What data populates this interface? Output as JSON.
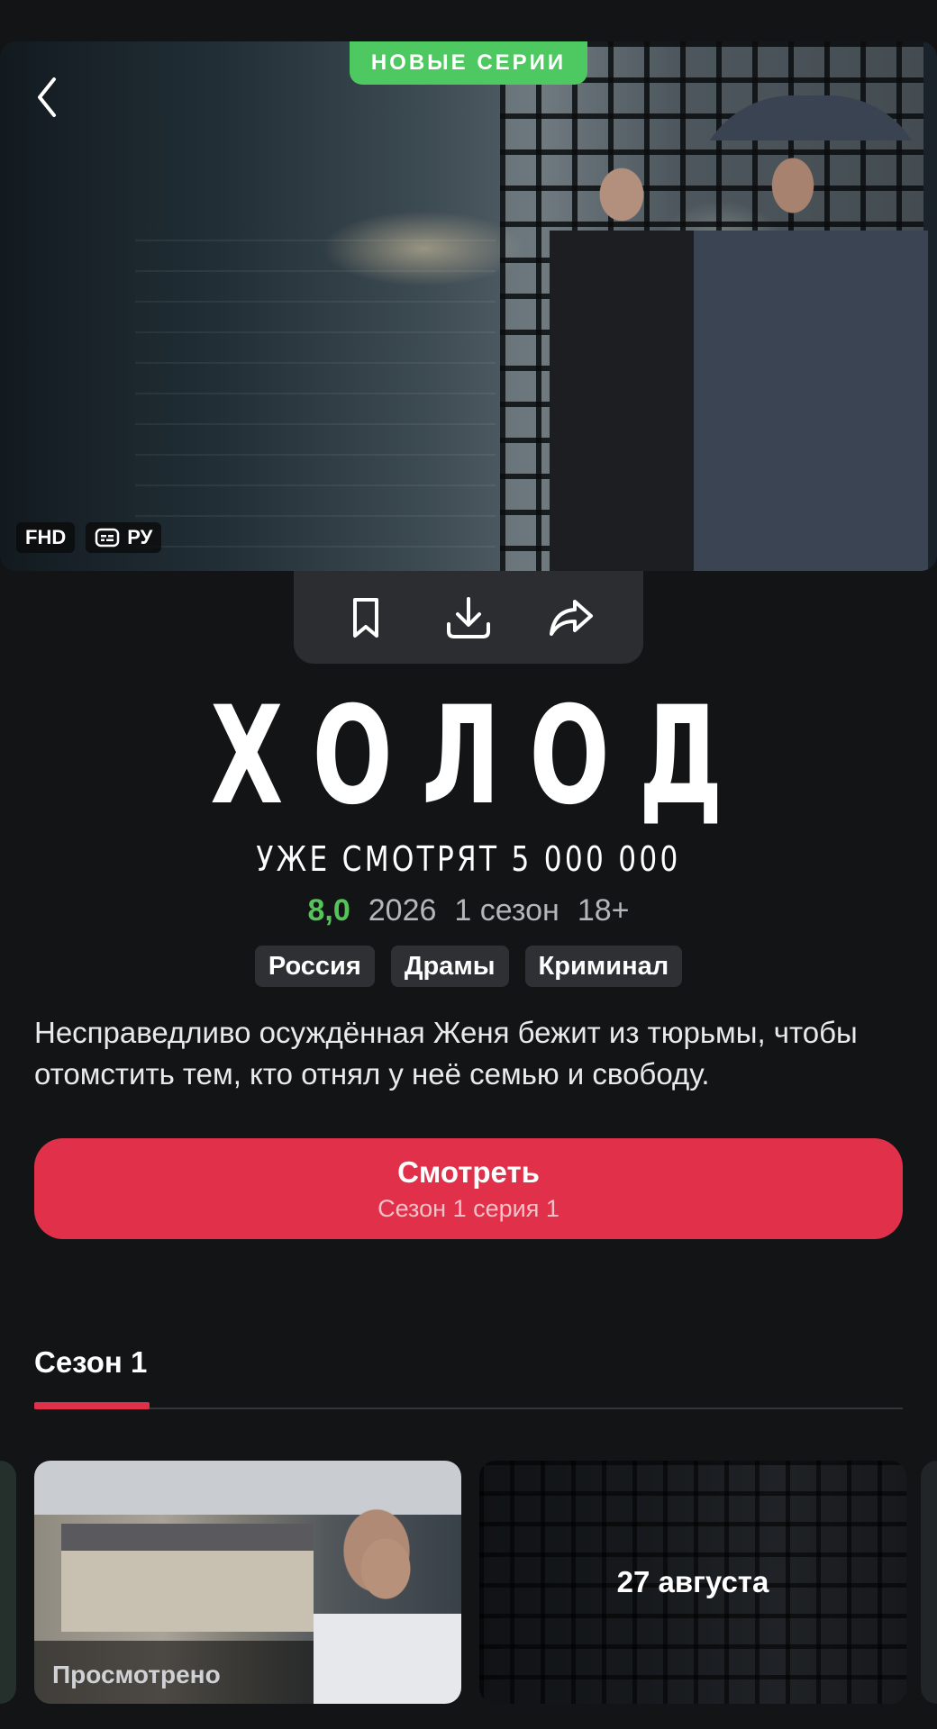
{
  "hero": {
    "badge": "НОВЫЕ СЕРИИ",
    "quality": "FHD",
    "subtitles": "РУ"
  },
  "show": {
    "title": "ХОЛОД",
    "watching": "УЖЕ СМОТРЯТ 5 000 000",
    "rating": "8,0",
    "year": "2026",
    "seasons": "1 сезон",
    "age": "18+",
    "genres": [
      "Россия",
      "Драмы",
      "Криминал"
    ],
    "description": "Несправедливо осуждённая Женя бежит из тюрьмы, чтобы отомстить тем, кто отнял у неё семью и свободу."
  },
  "watch_button": {
    "label": "Смотреть",
    "sublabel": "Сезон 1 серия 1"
  },
  "tabs": [
    {
      "label": "Сезон 1",
      "active": true
    }
  ],
  "episodes": [
    {
      "status": "Просмотрено"
    },
    {
      "release": "27 августа"
    }
  ],
  "colors": {
    "accent": "#e0304a",
    "new_badge": "#4ec860",
    "rating": "#56c35a",
    "background": "#131416"
  },
  "icons": [
    "back-chevron-icon",
    "subtitles-icon",
    "bookmark-icon",
    "download-icon",
    "share-icon"
  ]
}
